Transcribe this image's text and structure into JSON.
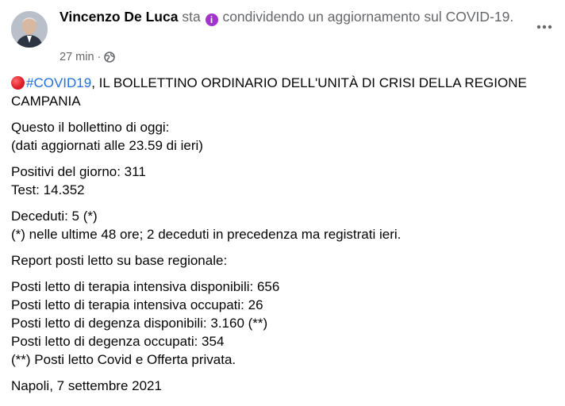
{
  "post": {
    "author": "Vincenzo De Luca",
    "verb": "sta",
    "activity": "condividendo un aggiornamento sul COVID-19.",
    "timestamp": "27 min",
    "meta_separator": "·",
    "hashtag": "#COVID19",
    "headline_rest": ", IL BOLLETTINO ORDINARIO DELL'UNITÀ DI CRISI DELLA REGIONE CAMPANIA",
    "paragraphs": [
      [
        "Questo il bollettino di oggi:",
        "(dati aggiornati alle 23.59 di ieri)"
      ],
      [
        "Positivi del giorno: 311",
        "Test: 14.352"
      ],
      [
        "Deceduti: 5 (*)",
        "(*) nelle ultime 48 ore; 2 deceduti in precedenza ma registrati ieri."
      ],
      [
        "Report posti letto su base regionale:"
      ],
      [
        "Posti letto di terapia intensiva disponibili: 656",
        "Posti letto di terapia intensiva occupati: 26",
        "Posti letto di degenza disponibili: 3.160 (**)",
        "Posti letto di degenza occupati: 354",
        "(**) Posti letto Covid e Offerta privata."
      ],
      [
        "Napoli, 7 settembre 2021"
      ]
    ]
  },
  "icons": {
    "feeling": "info-circle-icon",
    "audience": "globe-icon",
    "more": "more-options-icon",
    "headline_marker": "red-circle-emoji-icon"
  },
  "colors": {
    "hashtag": "#216fdb",
    "secondary_text": "#65676b",
    "feeling_icon": "#a334c9",
    "red_dot": "#e0202a"
  }
}
